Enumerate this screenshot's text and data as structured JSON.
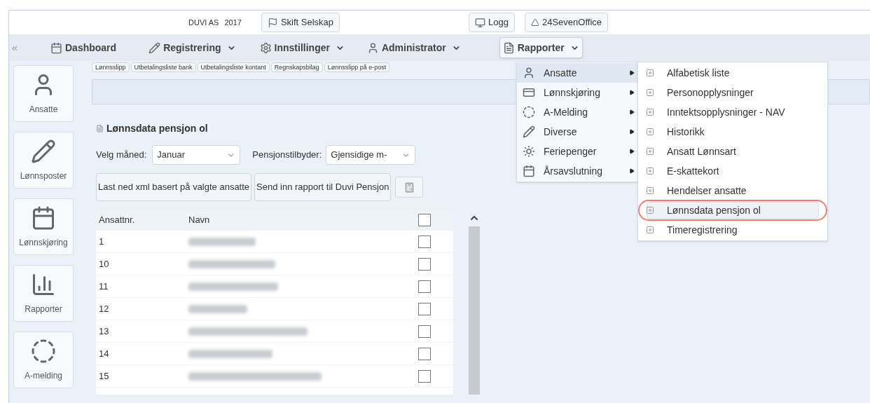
{
  "header": {
    "company": "DUVI AS",
    "year": "2017",
    "switch_button": "Skift Selskap",
    "log_button": "Logg",
    "brand_button": "24SevenOffice"
  },
  "nav": {
    "collapse": "«",
    "items": [
      {
        "label": "Dashboard",
        "dropdown": false,
        "selected": false
      },
      {
        "label": "Registrering",
        "dropdown": true,
        "selected": false
      },
      {
        "label": "Innstillinger",
        "dropdown": true,
        "selected": false
      },
      {
        "label": "Administrator",
        "dropdown": true,
        "selected": false
      },
      {
        "label": "Rapporter",
        "dropdown": true,
        "selected": true
      }
    ]
  },
  "sidebar": [
    {
      "label": "Ansatte"
    },
    {
      "label": "Lønnsposter"
    },
    {
      "label": "Lønnskjøring"
    },
    {
      "label": "Rapporter"
    },
    {
      "label": "A-melding"
    }
  ],
  "toolbar_tabs": [
    "Lønnsslipp",
    "Utbetalingsliste bank",
    "Utbetalingsliste kontant",
    "Regnskapsbilag",
    "Lønnsslipp på e-post"
  ],
  "panel": {
    "title": "Lønnsdata pensjon ol",
    "month_label": "Velg måned:",
    "month_value": "Januar",
    "provider_label": "Pensjonstilbyder:",
    "provider_value": "Gjensidige m-",
    "buttons": [
      "Last ned xml basert på valgte ansatte",
      "Send inn rapport til Duvi Pensjon"
    ]
  },
  "table": {
    "columns": [
      "Ansattnr.",
      "Navn"
    ],
    "header_checked": false,
    "rows": [
      {
        "number": "1",
        "checked": false
      },
      {
        "number": "10",
        "checked": false
      },
      {
        "number": "11",
        "checked": false
      },
      {
        "number": "12",
        "checked": false
      },
      {
        "number": "13",
        "checked": false
      },
      {
        "number": "14",
        "checked": false
      },
      {
        "number": "15",
        "checked": false
      }
    ]
  },
  "menu": {
    "items": [
      {
        "label": "Ansatte",
        "selected": true
      },
      {
        "label": "Lønnskjøring",
        "selected": false
      },
      {
        "label": "A-Melding",
        "selected": false
      },
      {
        "label": "Diverse",
        "selected": false
      },
      {
        "label": "Feriepenger",
        "selected": false
      },
      {
        "label": "Årsavslutning",
        "selected": false
      }
    ],
    "submenu": [
      {
        "label": "Alfabetisk liste",
        "selected": false,
        "circled": false
      },
      {
        "label": "Personopplysninger",
        "selected": false,
        "circled": false
      },
      {
        "label": "Inntektsopplysninger - NAV",
        "selected": false,
        "circled": false
      },
      {
        "label": "Historikk",
        "selected": false,
        "circled": false
      },
      {
        "label": "Ansatt Lønnsart",
        "selected": false,
        "circled": false
      },
      {
        "label": "E-skattekort",
        "selected": false,
        "circled": false
      },
      {
        "label": "Hendelser ansatte",
        "selected": false,
        "circled": false
      },
      {
        "label": "Lønnsdata pensjon ol",
        "selected": true,
        "circled": true
      },
      {
        "label": "Timeregistrering",
        "selected": false,
        "circled": false
      }
    ]
  }
}
